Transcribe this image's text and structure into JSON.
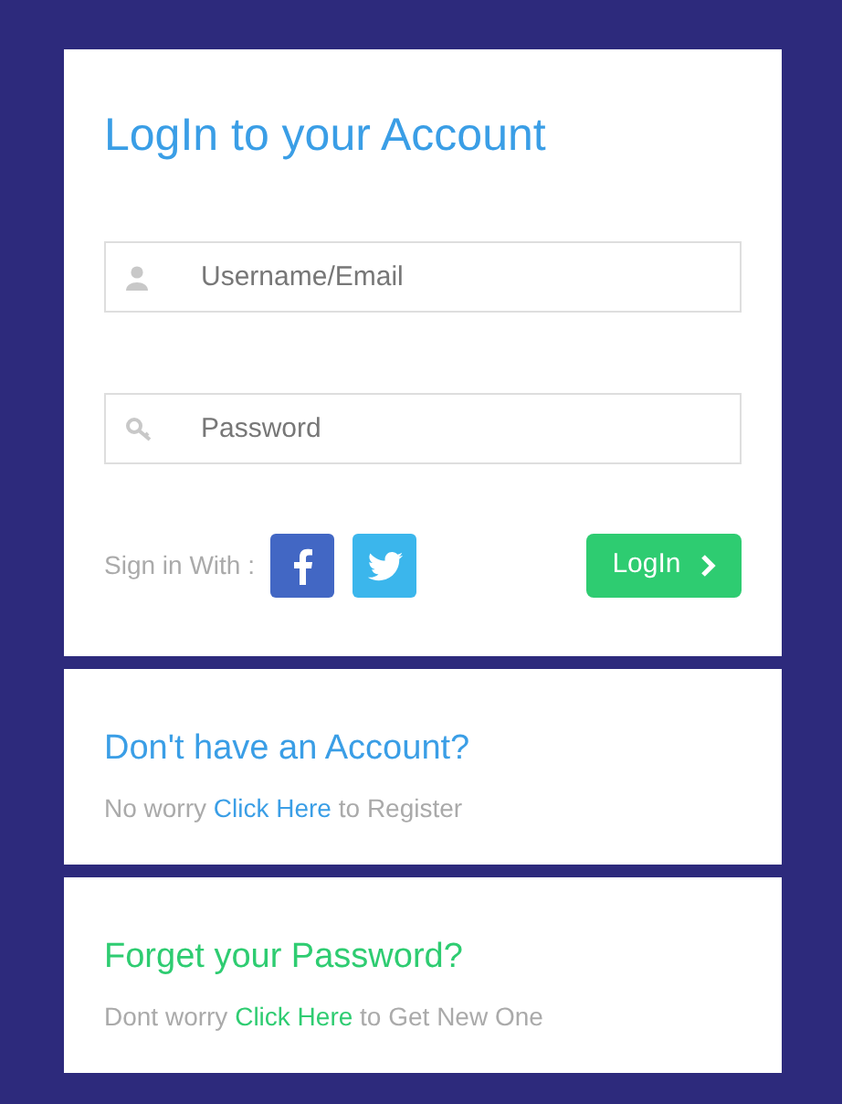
{
  "login": {
    "title": "LogIn to your Account",
    "fields": [
      {
        "kind": "user",
        "placeholder": "Username/Email"
      },
      {
        "kind": "password",
        "placeholder": "Password"
      }
    ],
    "social_label": "Sign in With :",
    "social": [
      {
        "kind": "facebook"
      },
      {
        "kind": "twitter"
      }
    ],
    "submit": "LogIn"
  },
  "panels": [
    {
      "heading": "Don't have an Account?",
      "color": "#3a9ee6",
      "before": "No worry",
      "link": "Click Here",
      "after": "to Register"
    },
    {
      "heading": "Forget your Password?",
      "color": "#2ecc71",
      "before": "Dont worry",
      "link": "Click Here",
      "after": "to Get New One"
    }
  ]
}
